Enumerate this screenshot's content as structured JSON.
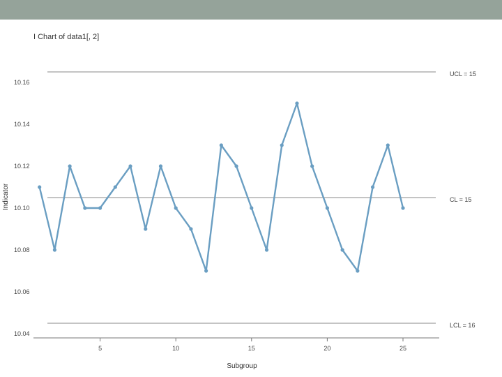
{
  "header": {
    "bar_color": "#95a39a"
  },
  "chart_data": {
    "type": "line",
    "title": "I Chart of data1[, 2]",
    "xlabel": "Subgroup",
    "ylabel": "Indicator",
    "x": [
      1,
      2,
      3,
      4,
      5,
      6,
      7,
      8,
      9,
      10,
      11,
      12,
      13,
      14,
      15,
      16,
      17,
      18,
      19,
      20,
      21,
      22,
      23,
      24,
      25
    ],
    "series": [
      {
        "values": [
          10.11,
          10.08,
          10.12,
          10.1,
          10.1,
          10.11,
          10.12,
          10.09,
          10.12,
          10.1,
          10.09,
          10.07,
          10.13,
          10.12,
          10.1,
          10.08,
          10.13,
          10.15,
          10.12,
          10.1,
          10.08,
          10.07,
          10.11,
          10.13,
          10.1
        ],
        "color": "#6a9ec2"
      }
    ],
    "xticks": [
      5,
      10,
      15,
      20,
      25
    ],
    "yticks": [
      10.04,
      10.06,
      10.08,
      10.1,
      10.12,
      10.14,
      10.16
    ],
    "ytick_labels": [
      "10.04",
      "10.06",
      "10.08",
      "10.10",
      "10.12",
      "10.14",
      "10.16"
    ],
    "xlim": [
      0.6,
      25.5
    ],
    "ylim": [
      10.04,
      10.16
    ],
    "control_limits": [
      {
        "label": "UCL = 15",
        "value": 10.165
      },
      {
        "label": "CL = 15",
        "value": 10.105
      },
      {
        "label": "LCL = 16",
        "value": 10.045
      }
    ],
    "grid": false,
    "limit_line_color": "#888888",
    "axis_color": "#777777"
  }
}
